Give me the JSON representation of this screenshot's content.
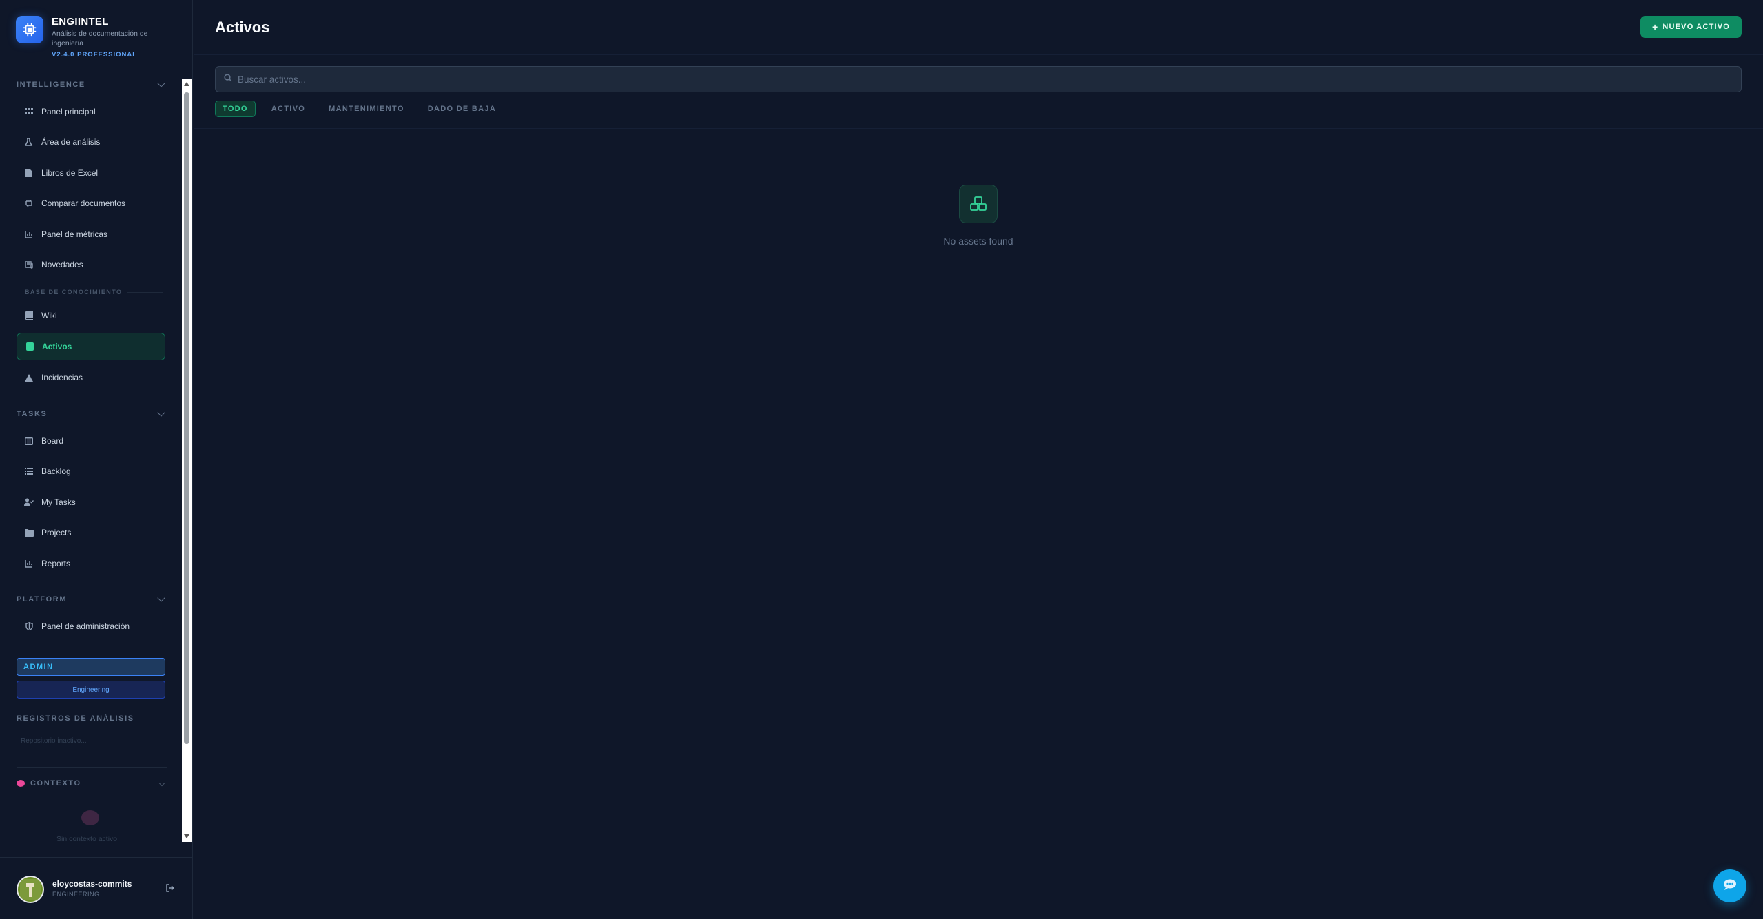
{
  "brand": {
    "name": "ENGIINTEL",
    "subtitle": "Análisis de documentación de ingeniería",
    "version": "V2.4.0 PROFESSIONAL"
  },
  "sections": {
    "intelligence": "INTELLIGENCE",
    "knowledge_base": "BASE DE CONOCIMIENTO",
    "tasks": "TASKS",
    "platform": "PLATFORM"
  },
  "nav": {
    "panel_principal": "Panel principal",
    "area_analisis": "Área de análisis",
    "libros_excel": "Libros de Excel",
    "comparar_documentos": "Comparar documentos",
    "panel_metricas": "Panel de métricas",
    "novedades": "Novedades",
    "wiki": "Wiki",
    "activos": "Activos",
    "incidencias": "Incidencias",
    "board": "Board",
    "backlog": "Backlog",
    "my_tasks": "My Tasks",
    "projects": "Projects",
    "reports": "Reports",
    "panel_admin": "Panel de administración"
  },
  "badges": {
    "role": "ADMIN",
    "department": "Engineering"
  },
  "analysis_logs": {
    "title": "REGISTROS DE ANÁLISIS",
    "empty": "Repositorio inactivo..."
  },
  "context": {
    "title": "CONTEXTO",
    "empty": "Sin contexto activo"
  },
  "user": {
    "name": "eloycostas-commits",
    "role": "ENGINEERING"
  },
  "main": {
    "title": "Activos",
    "new_button": "NUEVO ACTIVO",
    "search_placeholder": "Buscar activos...",
    "filters": [
      "TODO",
      "ACTIVO",
      "MANTENIMIENTO",
      "DADO DE BAJA"
    ],
    "active_filter": "TODO",
    "empty_message": "No assets found"
  },
  "colors": {
    "accent": "#10b981",
    "brand": "#3b82f6",
    "background": "#0f1729"
  }
}
